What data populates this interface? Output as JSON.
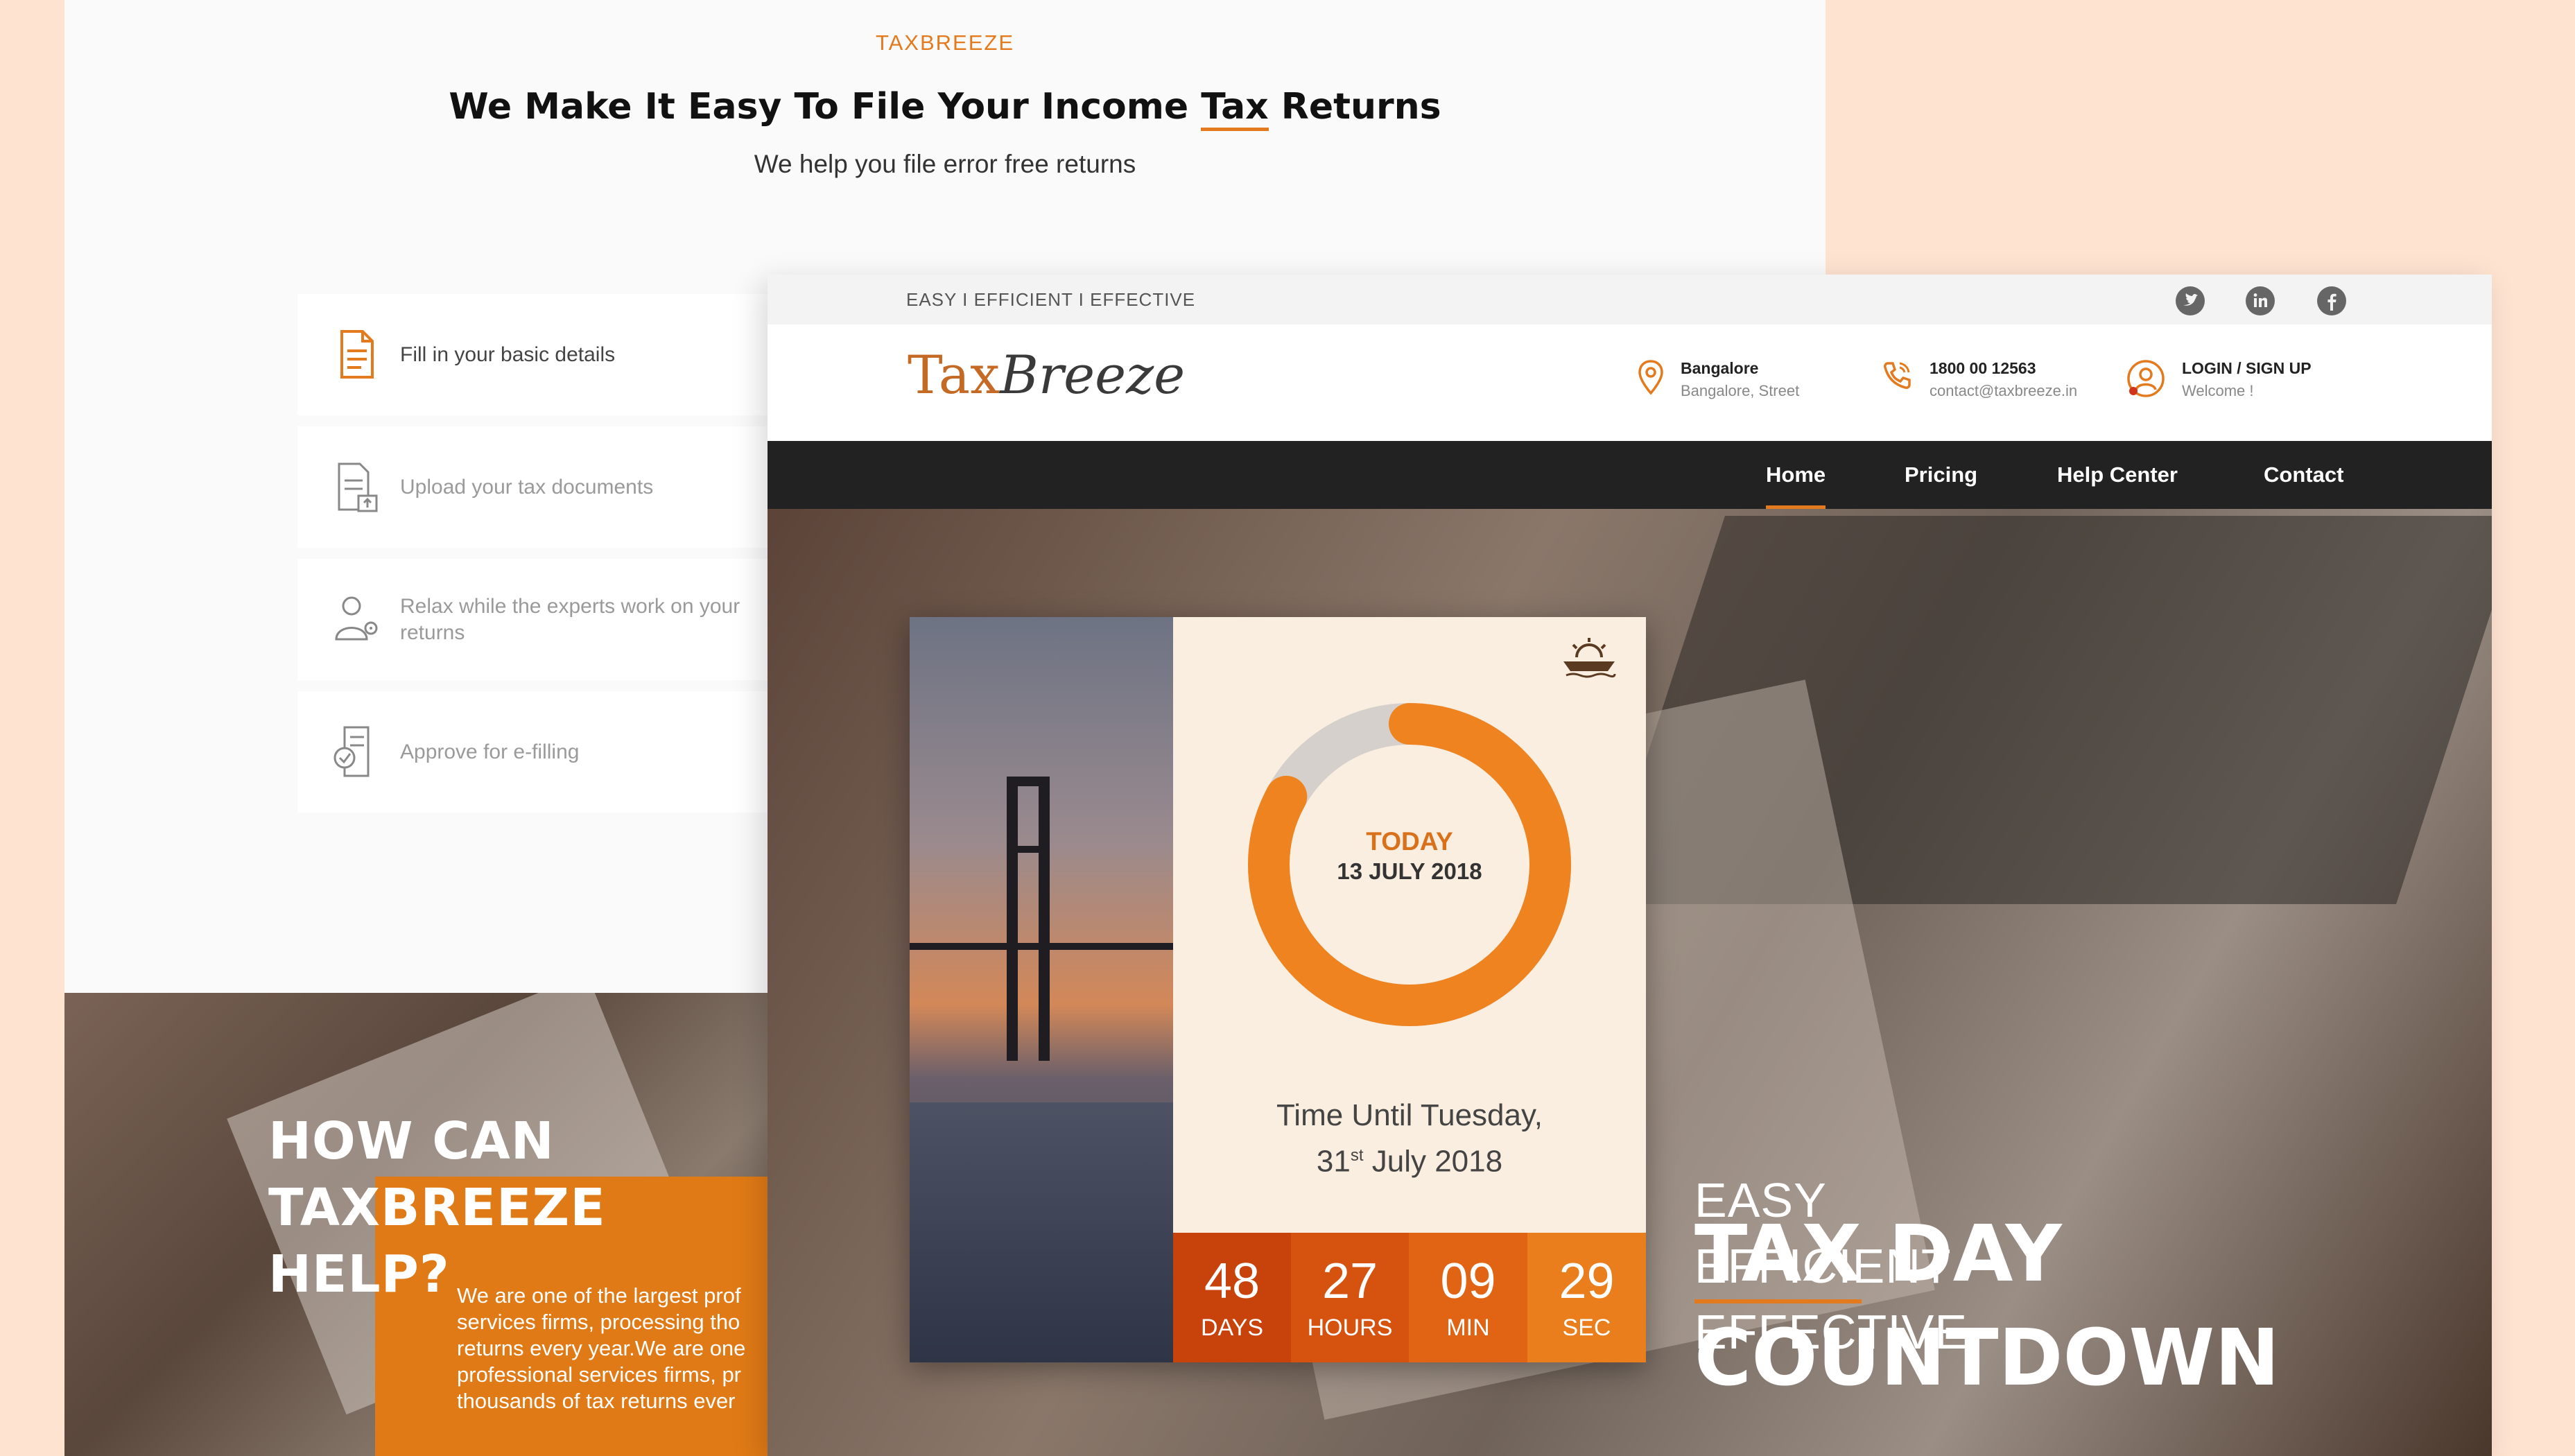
{
  "back_page": {
    "brand": "TAXBREEZE",
    "title_before": "We Make It Easy To File Your Income ",
    "title_highlight": "Tax",
    "title_after": " Returns",
    "subtitle": "We help you file error free returns",
    "steps": [
      {
        "label": "Fill in your basic details",
        "icon": "document-icon",
        "active": true
      },
      {
        "label": "Upload your tax documents",
        "icon": "upload-document-icon",
        "active": false
      },
      {
        "label": "Relax while the experts work on your returns",
        "icon": "expert-icon",
        "active": false
      },
      {
        "label": "Approve for e-filling",
        "icon": "approve-document-icon",
        "active": false
      }
    ],
    "help": {
      "title_lines": [
        "HOW CAN",
        "TAXBREEZE",
        "HELP?"
      ],
      "text_lines": [
        "We are one of the largest prof",
        "services firms, processing tho",
        "returns every year.We are one",
        "professional services firms, pr",
        "thousands of tax returns ever"
      ]
    }
  },
  "front_page": {
    "tagline": "EASY I EFFICIENT I EFFECTIVE",
    "social": [
      "twitter-icon",
      "linkedin-icon",
      "facebook-icon"
    ],
    "logo": {
      "part1": "Tax",
      "part2": "Breeze"
    },
    "contact": {
      "location_title": "Bangalore",
      "location_sub": "Bangalore, Street",
      "phone": "1800 00 12563",
      "email": "contact@taxbreeze.in",
      "login": "LOGIN / SIGN UP",
      "welcome": "Welcome !"
    },
    "nav": [
      "Home",
      "Pricing",
      "Help Center",
      "Contact"
    ],
    "active_nav": "Home",
    "countdown": {
      "today_label": "TODAY",
      "today_date": "13 JULY 2018",
      "until_line1": "Time Until Tuesday,",
      "until_day": "31",
      "until_sup": "st",
      "until_rest": " July 2018",
      "progress_fraction": 0.83,
      "units": [
        {
          "value": "48",
          "label": "DAYS"
        },
        {
          "value": "27",
          "label": "HOURS"
        },
        {
          "value": "09",
          "label": "MIN"
        },
        {
          "value": "29",
          "label": "SEC"
        }
      ]
    },
    "slogan": [
      "EASY",
      "EFFICIENT",
      "EFFECTIVE"
    ],
    "headline_part1": "TAX",
    "headline_part2": " DAY",
    "headline_line2": "COUNTDOWN"
  },
  "colors": {
    "accent": "#e47a1e",
    "background": "#ffe3d1",
    "navbar": "#222222",
    "cd_days": "#c8420c",
    "cd_hours": "#d5520f",
    "cd_min": "#e06414",
    "cd_sec": "#ea7d1c"
  }
}
